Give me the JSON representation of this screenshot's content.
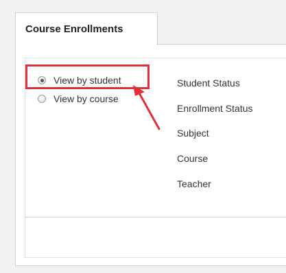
{
  "tab": {
    "label": "Course Enrollments"
  },
  "view_options": [
    {
      "label": "View by student",
      "checked": true
    },
    {
      "label": "View by course",
      "checked": false
    }
  ],
  "filters": [
    "Student Status",
    "Enrollment Status",
    "Subject",
    "Course",
    "Teacher"
  ],
  "annotation": {
    "color": "#e0303a"
  }
}
